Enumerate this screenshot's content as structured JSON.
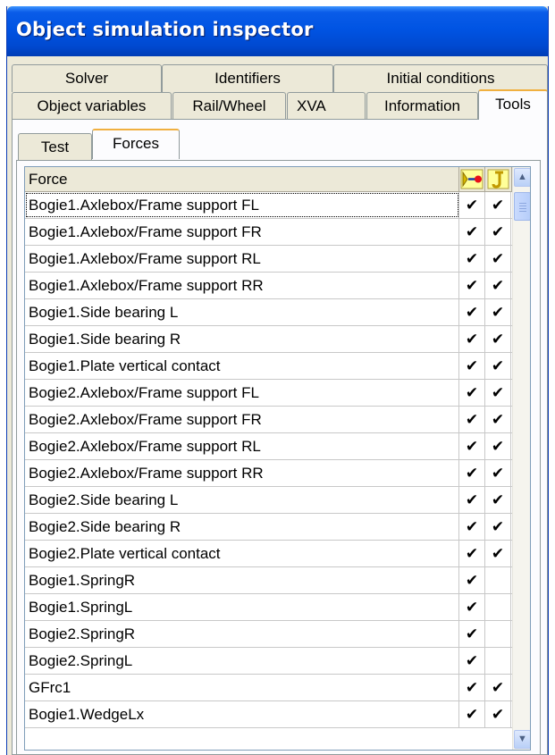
{
  "window": {
    "title": "Object simulation inspector"
  },
  "tabs_row1": [
    {
      "label": "Solver"
    },
    {
      "label": "Identifiers"
    },
    {
      "label": "Initial conditions"
    }
  ],
  "tabs_row2": [
    {
      "label": "Object variables"
    },
    {
      "label": "Rail/Wheel"
    },
    {
      "label": "XVA"
    },
    {
      "label": "Information"
    },
    {
      "label": "Tools",
      "active": true
    }
  ],
  "subtabs": [
    {
      "label": "Test"
    },
    {
      "label": "Forces",
      "active": true
    }
  ],
  "grid": {
    "header": {
      "name": "Force",
      "col1_icon": "force-arrow-icon",
      "col2_icon": "joint-icon"
    },
    "check_glyph": "✔",
    "rows": [
      {
        "name": "Bogie1.Axlebox/Frame support FL",
        "c1": true,
        "c2": true
      },
      {
        "name": "Bogie1.Axlebox/Frame support FR",
        "c1": true,
        "c2": true
      },
      {
        "name": "Bogie1.Axlebox/Frame support RL",
        "c1": true,
        "c2": true
      },
      {
        "name": "Bogie1.Axlebox/Frame support RR",
        "c1": true,
        "c2": true
      },
      {
        "name": "Bogie1.Side bearing L",
        "c1": true,
        "c2": true
      },
      {
        "name": "Bogie1.Side bearing R",
        "c1": true,
        "c2": true
      },
      {
        "name": "Bogie1.Plate vertical contact",
        "c1": true,
        "c2": true
      },
      {
        "name": "Bogie2.Axlebox/Frame support FL",
        "c1": true,
        "c2": true
      },
      {
        "name": "Bogie2.Axlebox/Frame support FR",
        "c1": true,
        "c2": true
      },
      {
        "name": "Bogie2.Axlebox/Frame support RL",
        "c1": true,
        "c2": true
      },
      {
        "name": "Bogie2.Axlebox/Frame support RR",
        "c1": true,
        "c2": true
      },
      {
        "name": "Bogie2.Side bearing L",
        "c1": true,
        "c2": true
      },
      {
        "name": "Bogie2.Side bearing R",
        "c1": true,
        "c2": true
      },
      {
        "name": "Bogie2.Plate vertical contact",
        "c1": true,
        "c2": true
      },
      {
        "name": "Bogie1.SpringR",
        "c1": true,
        "c2": false
      },
      {
        "name": "Bogie1.SpringL",
        "c1": true,
        "c2": false
      },
      {
        "name": "Bogie2.SpringR",
        "c1": true,
        "c2": false
      },
      {
        "name": "Bogie2.SpringL",
        "c1": true,
        "c2": false
      },
      {
        "name": "GFrc1",
        "c1": true,
        "c2": true
      },
      {
        "name": "Bogie1.WedgeLx",
        "c1": true,
        "c2": true
      }
    ]
  },
  "scrollbar": {
    "up_icon": "chevron-up-icon",
    "down_icon": "chevron-down-icon"
  },
  "colors": {
    "titlebar": "#0054e3",
    "face": "#ece9d8",
    "active_tab_accent": "#f0b040"
  }
}
